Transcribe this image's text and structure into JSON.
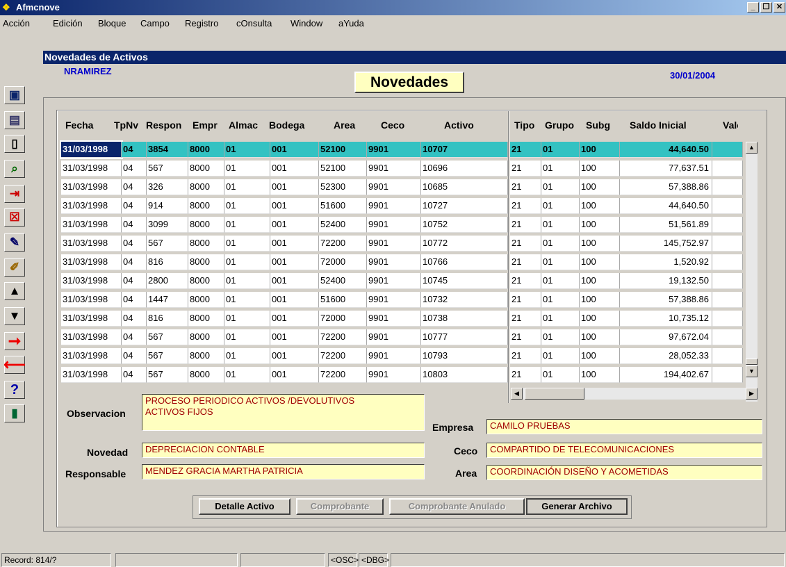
{
  "window": {
    "title": "Afmcnove"
  },
  "menu": [
    "Acción",
    "Edición",
    "Bloque",
    "Campo",
    "Registro",
    "cOnsulta",
    "Window",
    "aYuda"
  ],
  "form": {
    "header": "Novedades de Activos",
    "user": "NRAMIREZ",
    "date": "30/01/2004",
    "title": "Novedades"
  },
  "toolbar": [
    "save-icon",
    "form-icon",
    "clipboard-icon",
    "query-icon",
    "insert-record-icon",
    "delete-record-icon",
    "clear-icon",
    "edit-icon",
    "previous-record-icon",
    "next-record-icon",
    "forward-arrow-icon",
    "back-arrow-icon",
    "help-icon",
    "exit-icon"
  ],
  "grid": {
    "columns": [
      "Fecha",
      "TpNv",
      "Respon",
      "Empr",
      "Almac",
      "Bodega",
      "Area",
      "Ceco",
      "Activo",
      "Tipo",
      "Grupo",
      "Subg",
      "Saldo Inicial",
      "Valo"
    ],
    "rows": [
      [
        "31/03/1998",
        "04",
        "3854",
        "8000",
        "01",
        "001",
        "52100",
        "9901",
        "10707",
        "21",
        "01",
        "100",
        "44,640.50"
      ],
      [
        "31/03/1998",
        "04",
        "567",
        "8000",
        "01",
        "001",
        "52100",
        "9901",
        "10696",
        "21",
        "01",
        "100",
        "77,637.51"
      ],
      [
        "31/03/1998",
        "04",
        "326",
        "8000",
        "01",
        "001",
        "52300",
        "9901",
        "10685",
        "21",
        "01",
        "100",
        "57,388.86"
      ],
      [
        "31/03/1998",
        "04",
        "914",
        "8000",
        "01",
        "001",
        "51600",
        "9901",
        "10727",
        "21",
        "01",
        "100",
        "44,640.50"
      ],
      [
        "31/03/1998",
        "04",
        "3099",
        "8000",
        "01",
        "001",
        "52400",
        "9901",
        "10752",
        "21",
        "01",
        "100",
        "51,561.89"
      ],
      [
        "31/03/1998",
        "04",
        "567",
        "8000",
        "01",
        "001",
        "72200",
        "9901",
        "10772",
        "21",
        "01",
        "100",
        "145,752.97"
      ],
      [
        "31/03/1998",
        "04",
        "816",
        "8000",
        "01",
        "001",
        "72000",
        "9901",
        "10766",
        "21",
        "01",
        "100",
        "1,520.92"
      ],
      [
        "31/03/1998",
        "04",
        "2800",
        "8000",
        "01",
        "001",
        "52400",
        "9901",
        "10745",
        "21",
        "01",
        "100",
        "19,132.50"
      ],
      [
        "31/03/1998",
        "04",
        "1447",
        "8000",
        "01",
        "001",
        "51600",
        "9901",
        "10732",
        "21",
        "01",
        "100",
        "57,388.86"
      ],
      [
        "31/03/1998",
        "04",
        "816",
        "8000",
        "01",
        "001",
        "72000",
        "9901",
        "10738",
        "21",
        "01",
        "100",
        "10,735.12"
      ],
      [
        "31/03/1998",
        "04",
        "567",
        "8000",
        "01",
        "001",
        "72200",
        "9901",
        "10777",
        "21",
        "01",
        "100",
        "97,672.04"
      ],
      [
        "31/03/1998",
        "04",
        "567",
        "8000",
        "01",
        "001",
        "72200",
        "9901",
        "10793",
        "21",
        "01",
        "100",
        "28,052.33"
      ],
      [
        "31/03/1998",
        "04",
        "567",
        "8000",
        "01",
        "001",
        "72200",
        "9901",
        "10803",
        "21",
        "01",
        "100",
        "194,402.67"
      ]
    ]
  },
  "details": {
    "observacion_label": "Observacion",
    "observacion": "PROCESO PERIODICO ACTIVOS /DEVOLUTIVOS\nACTIVOS FIJOS",
    "novedad_label": "Novedad",
    "novedad": "DEPRECIACION CONTABLE",
    "responsable_label": "Responsable",
    "responsable": "MENDEZ GRACIA MARTHA PATRICIA",
    "empresa_label": "Empresa",
    "empresa": "CAMILO PRUEBAS",
    "ceco_label": "Ceco",
    "ceco": "COMPARTIDO DE TELECOMUNICACIONES",
    "area_label": "Area",
    "area": "COORDINACIÓN DISEÑO Y ACOMETIDAS"
  },
  "buttons": {
    "detalle": "Detalle Activo",
    "comprobante": "Comprobante",
    "comprobante_anulado": "Comprobante Anulado",
    "generar": "Generar Archivo"
  },
  "status": {
    "record": "Record: 814/?",
    "osc": "<OSC>",
    "dbg": "<DBG>"
  }
}
